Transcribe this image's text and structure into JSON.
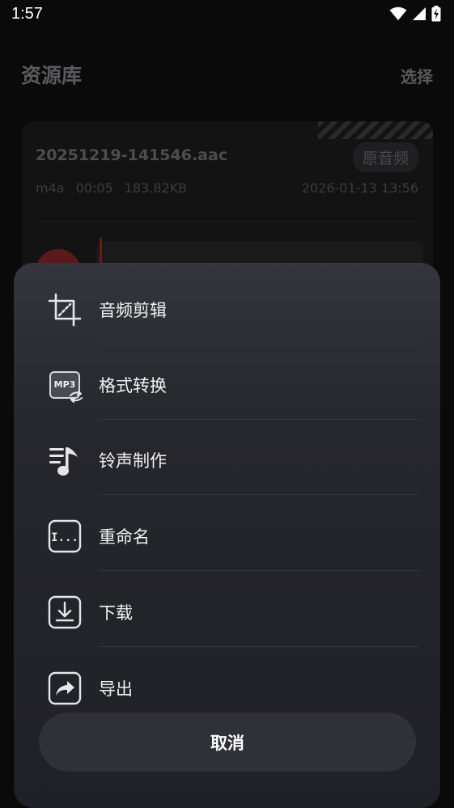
{
  "status_bar": {
    "time": "1:57",
    "icons": [
      "wifi-icon",
      "signal-icon",
      "battery-charging-icon"
    ]
  },
  "header": {
    "title": "资源库",
    "select_label": "选择"
  },
  "file_card": {
    "name": "20251219-141546.aac",
    "badge": "原音频",
    "format": "m4a",
    "duration": "00:05",
    "size": "183.82KB",
    "date": "2026-01-13 13:56"
  },
  "sheet": {
    "items": [
      {
        "label": "音频剪辑",
        "icon": "crop-icon"
      },
      {
        "label": "格式转换",
        "icon": "mp3-convert-icon",
        "icon_text": "MP3"
      },
      {
        "label": "铃声制作",
        "icon": "ringtone-icon"
      },
      {
        "label": "重命名",
        "icon": "rename-icon",
        "icon_text": "I..."
      },
      {
        "label": "下载",
        "icon": "download-icon"
      },
      {
        "label": "导出",
        "icon": "share-icon"
      }
    ],
    "cancel_label": "取消"
  },
  "colors": {
    "sheet_bg": "#26272d",
    "cancel_bg": "#303138",
    "accent_red": "#c0302a"
  }
}
